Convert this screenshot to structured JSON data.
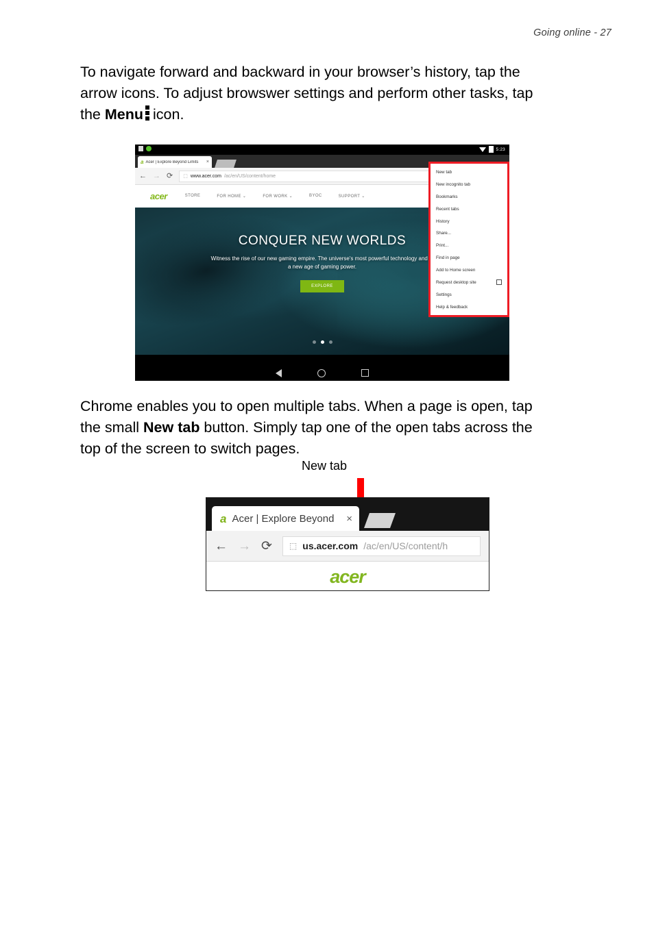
{
  "page": {
    "header": "Going online - 27"
  },
  "paragraph1": {
    "line1": "To navigate forward and backward in your browser’s history, tap the",
    "line2": "arrow icons. To adjust browswer settings and perform other tasks, tap",
    "line3_pre": "the ",
    "line3_bold": "Menu",
    "line3_post": "icon."
  },
  "paragraph2": {
    "line1": "Chrome enables you to open multiple tabs. When a page is open, tap",
    "line2_pre": "the small ",
    "line2_bold": "New tab",
    "line2_post": " button. Simply tap one of the open tabs across the",
    "line3": "top of the screen to switch pages."
  },
  "figure_tablet": {
    "statusbar": {
      "time": "5:23",
      "wifi_icon": "wifi-icon",
      "battery_icon": "battery-icon",
      "screenshot_icon": "screenshot-icon",
      "record_icon": "record-icon"
    },
    "tab": {
      "favicon_letter": "a",
      "title": "Acer | Explore Beyond Limits",
      "close_glyph": "×",
      "new_tab_name": "new-tab-button"
    },
    "urlbar": {
      "back_glyph": "←",
      "forward_glyph": "→",
      "reload_glyph": "⟳",
      "page_glyph": "⬚",
      "host": "www.acer.com",
      "path": "/ac/en/US/content/home"
    },
    "site": {
      "logo": "acer",
      "nav": [
        "STORE",
        "FOR HOME ⌄",
        "FOR WORK ⌄",
        "BYOC",
        "SUPPORT ⌄"
      ]
    },
    "hero": {
      "title": "CONQUER NEW WORLDS",
      "subtitle": "Witness the rise of our new gaming empire. The universe's most powerful technology and in a new age of gaming power.",
      "button": "EXPLORE",
      "carousel_dots": 3,
      "carousel_active_index": 1
    },
    "menu": {
      "highlight_color": "#ee1c25",
      "items": [
        {
          "label": "New tab",
          "checkbox": false
        },
        {
          "label": "New incognito tab",
          "checkbox": false
        },
        {
          "label": "Bookmarks",
          "checkbox": false
        },
        {
          "label": "Recent tabs",
          "checkbox": false
        },
        {
          "label": "History",
          "checkbox": false
        },
        {
          "label": "Share...",
          "checkbox": false
        },
        {
          "label": "Print...",
          "checkbox": false
        },
        {
          "label": "Find in page",
          "checkbox": false
        },
        {
          "label": "Add to Home screen",
          "checkbox": false
        },
        {
          "label": "Request desktop site",
          "checkbox": true
        },
        {
          "label": "Settings",
          "checkbox": false
        },
        {
          "label": "Help & feedback",
          "checkbox": false
        }
      ]
    },
    "navbar": {
      "back": "back-button",
      "home": "home-button",
      "recents": "recents-button"
    }
  },
  "figure_newtab": {
    "callout_label": "New tab",
    "arrow_color": "#ff0000",
    "tab": {
      "favicon_letter": "a",
      "title": "Acer | Explore Beyond",
      "close_glyph": "×"
    },
    "urlbar": {
      "back_glyph": "←",
      "forward_glyph": "→",
      "reload_glyph": "⟳",
      "page_glyph": "⬚",
      "host": "us.acer.com",
      "path": "/ac/en/US/content/h"
    },
    "content": {
      "logo": "acer"
    }
  }
}
